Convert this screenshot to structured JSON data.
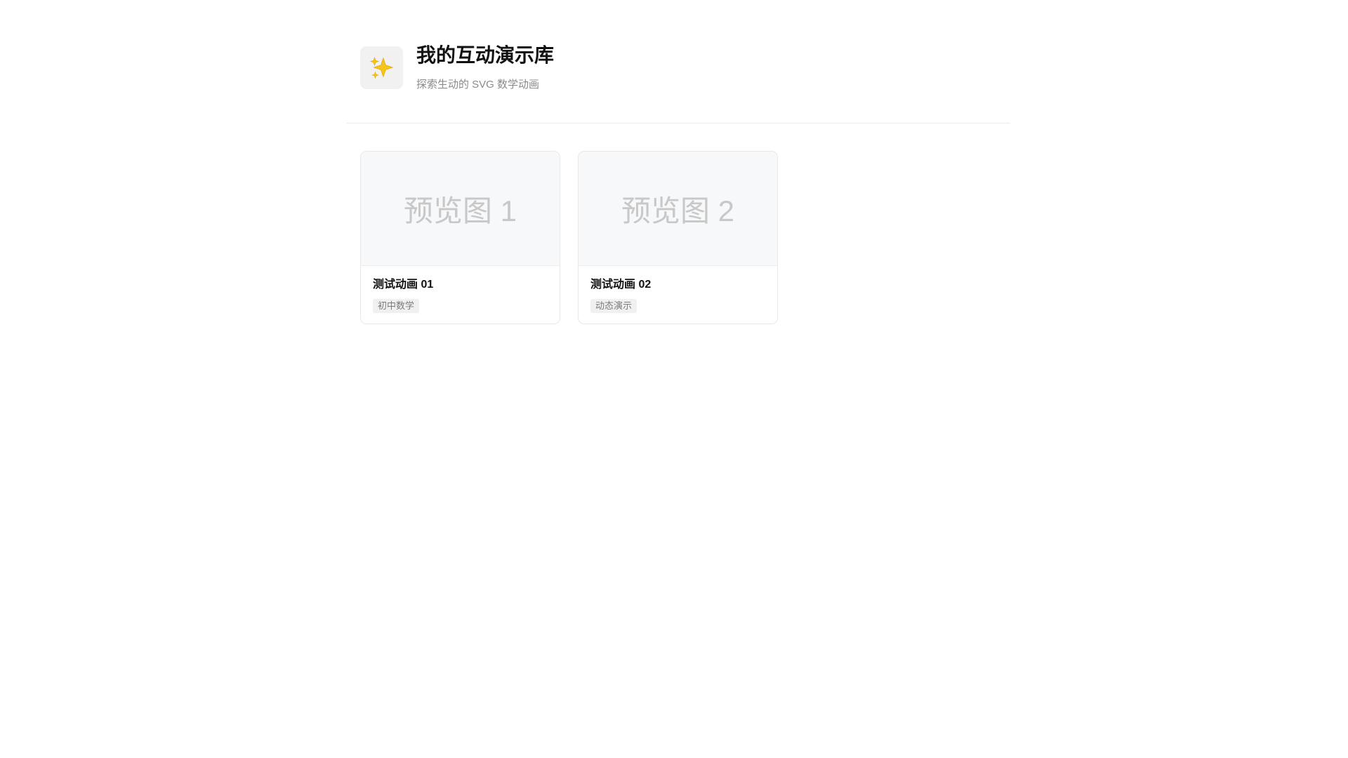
{
  "header": {
    "logo_icon": "sparkles-icon",
    "title": "我的互动演示库",
    "subtitle": "探索生动的 SVG 数学动画"
  },
  "cards": [
    {
      "preview_label": "预览图 1",
      "title": "测试动画 01",
      "tag": "初中数学"
    },
    {
      "preview_label": "预览图 2",
      "title": "测试动画 02",
      "tag": "动态演示"
    }
  ],
  "colors": {
    "background": "#ffffff",
    "logo_bg": "#f1f1f1",
    "preview_bg": "#f7f8fa",
    "sparkle": "#f5c518"
  }
}
